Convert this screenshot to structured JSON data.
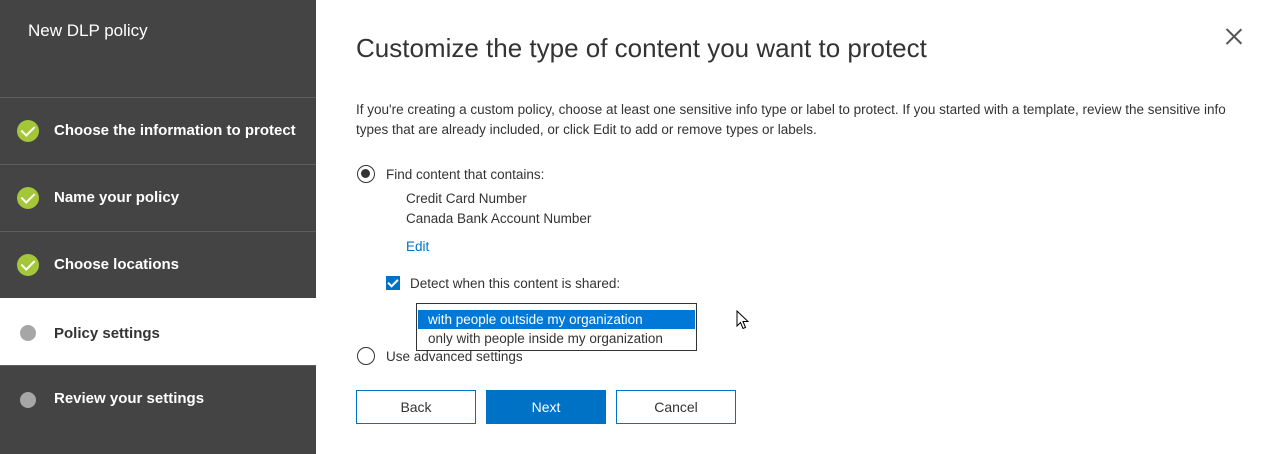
{
  "sidebar": {
    "title": "New DLP policy",
    "steps": [
      {
        "label": "Choose the information to protect",
        "state": "done"
      },
      {
        "label": "Name your policy",
        "state": "done"
      },
      {
        "label": "Choose locations",
        "state": "done"
      },
      {
        "label": "Policy settings",
        "state": "active"
      },
      {
        "label": "Review your settings",
        "state": "pending"
      }
    ]
  },
  "main": {
    "title": "Customize the type of content you want to protect",
    "description": "If you're creating a custom policy, choose at least one sensitive info type or label to protect. If you started with a template, review the sensitive info types that are already included, or click Edit to add or remove types or labels.",
    "option_find": {
      "label": "Find content that contains:",
      "selected": true,
      "info_types": [
        "Credit Card Number",
        "Canada Bank Account Number"
      ],
      "edit_label": "Edit"
    },
    "detect_shared": {
      "label": "Detect when this content is shared:",
      "checked": true,
      "options": [
        "with people outside my organization",
        "only with people inside my organization"
      ],
      "selected_option": "with people outside my organization"
    },
    "option_advanced": {
      "label": "Use advanced settings",
      "selected": false
    }
  },
  "buttons": {
    "back": "Back",
    "next": "Next",
    "cancel": "Cancel"
  },
  "colors": {
    "sidebar_bg": "#444444",
    "done_check": "#a4c639",
    "accent": "#0072c6",
    "selected_option": "#0078d7"
  },
  "icons": {
    "close": "close-icon",
    "check": "checkmark-icon",
    "cursor": "mouse-pointer-icon"
  }
}
